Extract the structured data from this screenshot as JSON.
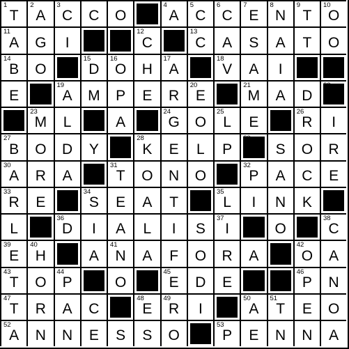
{
  "grid": {
    "rows": [
      [
        "T",
        "A",
        "C",
        "C",
        "O",
        "#",
        "A",
        "C",
        "C",
        "E",
        "N",
        "T",
        "O"
      ],
      [
        "A",
        "G",
        "I",
        "#",
        "#",
        "C",
        "#",
        "C",
        "A",
        "S",
        "A",
        "T",
        "O"
      ],
      [
        "B",
        "O",
        "#",
        "D",
        "O",
        "H",
        "A",
        "#",
        "V",
        "A",
        "I",
        "#",
        "#"
      ],
      [
        "E",
        "#",
        "A",
        "M",
        "P",
        "E",
        "R",
        "E",
        "#",
        "M",
        "A",
        "D",
        "#"
      ],
      [
        "#",
        "M",
        "L",
        "#",
        "A",
        "#",
        "G",
        "O",
        "L",
        "E",
        "#",
        "R",
        "I"
      ],
      [
        "B",
        "O",
        "D",
        "Y",
        "#",
        "K",
        "E",
        "L",
        "P",
        "#",
        "S",
        "O",
        "R"
      ],
      [
        "A",
        "R",
        "A",
        "#",
        "T",
        "O",
        "N",
        "O",
        "#",
        "P",
        "A",
        "C",
        "E"
      ],
      [
        "R",
        "E",
        "#",
        "S",
        "E",
        "A",
        "T",
        "#",
        "L",
        "I",
        "N",
        "K",
        "#"
      ],
      [
        "L",
        "#",
        "D",
        "I",
        "A",
        "L",
        "I",
        "S",
        "I",
        "#",
        "O",
        "#",
        "C"
      ],
      [
        "E",
        "H",
        "#",
        "A",
        "N",
        "A",
        "F",
        "O",
        "R",
        "A",
        "#",
        "O",
        "A"
      ],
      [
        "T",
        "O",
        "P",
        "#",
        "O",
        "#",
        "E",
        "D",
        "E",
        "#",
        "#",
        "P",
        "N"
      ],
      [
        "T",
        "R",
        "A",
        "C",
        "#",
        "E",
        "R",
        "I",
        "#",
        "A",
        "T",
        "E",
        "O"
      ],
      [
        "A",
        "N",
        "N",
        "E",
        "S",
        "S",
        "O",
        "#",
        "P",
        "E",
        "N",
        "N",
        "A"
      ]
    ],
    "numbers": [
      [
        1,
        2,
        3,
        0,
        0,
        0,
        4,
        0,
        5,
        6,
        7,
        8,
        9,
        10
      ],
      [
        11,
        0,
        0,
        0,
        0,
        12,
        0,
        13,
        0,
        0,
        0,
        0,
        0
      ],
      [
        14,
        0,
        0,
        15,
        16,
        0,
        17,
        0,
        18,
        0,
        0,
        0,
        0
      ],
      [
        0,
        0,
        19,
        0,
        0,
        0,
        0,
        20,
        0,
        21,
        0,
        0,
        22
      ],
      [
        0,
        23,
        0,
        0,
        0,
        0,
        24,
        0,
        25,
        0,
        0,
        26,
        0
      ],
      [
        27,
        0,
        0,
        0,
        0,
        28,
        0,
        0,
        0,
        0,
        29,
        0,
        0
      ],
      [
        30,
        0,
        0,
        0,
        31,
        0,
        0,
        0,
        0,
        32,
        0,
        0,
        0
      ],
      [
        33,
        0,
        0,
        34,
        0,
        0,
        0,
        0,
        35,
        0,
        0,
        0,
        0
      ],
      [
        0,
        0,
        36,
        0,
        0,
        0,
        0,
        0,
        37,
        0,
        0,
        0,
        38
      ],
      [
        39,
        40,
        0,
        0,
        41,
        0,
        0,
        0,
        0,
        0,
        0,
        42,
        0
      ],
      [
        43,
        0,
        44,
        0,
        0,
        0,
        45,
        0,
        0,
        0,
        0,
        0,
        46
      ],
      [
        47,
        0,
        0,
        0,
        0,
        48,
        49,
        0,
        0,
        0,
        50,
        51,
        0
      ],
      [
        52,
        0,
        0,
        0,
        0,
        0,
        0,
        0,
        53,
        0,
        0,
        0,
        0
      ]
    ]
  },
  "labels": {
    "r0": [
      "1",
      "2",
      "3",
      "",
      "",
      "",
      "4",
      "",
      "5",
      "6",
      "7",
      "8",
      "9",
      "10"
    ]
  }
}
